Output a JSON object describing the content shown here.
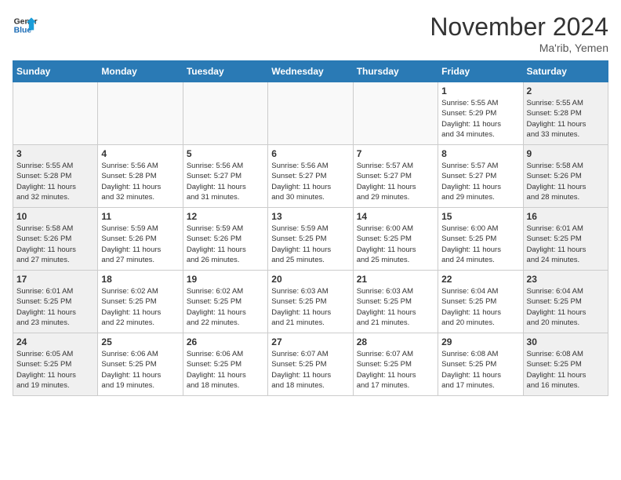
{
  "header": {
    "logo_line1": "General",
    "logo_line2": "Blue",
    "month": "November 2024",
    "location": "Ma'rib, Yemen"
  },
  "weekdays": [
    "Sunday",
    "Monday",
    "Tuesday",
    "Wednesday",
    "Thursday",
    "Friday",
    "Saturday"
  ],
  "weeks": [
    [
      {
        "day": "",
        "info": ""
      },
      {
        "day": "",
        "info": ""
      },
      {
        "day": "",
        "info": ""
      },
      {
        "day": "",
        "info": ""
      },
      {
        "day": "",
        "info": ""
      },
      {
        "day": "1",
        "info": "Sunrise: 5:55 AM\nSunset: 5:29 PM\nDaylight: 11 hours\nand 34 minutes."
      },
      {
        "day": "2",
        "info": "Sunrise: 5:55 AM\nSunset: 5:28 PM\nDaylight: 11 hours\nand 33 minutes."
      }
    ],
    [
      {
        "day": "3",
        "info": "Sunrise: 5:55 AM\nSunset: 5:28 PM\nDaylight: 11 hours\nand 32 minutes."
      },
      {
        "day": "4",
        "info": "Sunrise: 5:56 AM\nSunset: 5:28 PM\nDaylight: 11 hours\nand 32 minutes."
      },
      {
        "day": "5",
        "info": "Sunrise: 5:56 AM\nSunset: 5:27 PM\nDaylight: 11 hours\nand 31 minutes."
      },
      {
        "day": "6",
        "info": "Sunrise: 5:56 AM\nSunset: 5:27 PM\nDaylight: 11 hours\nand 30 minutes."
      },
      {
        "day": "7",
        "info": "Sunrise: 5:57 AM\nSunset: 5:27 PM\nDaylight: 11 hours\nand 29 minutes."
      },
      {
        "day": "8",
        "info": "Sunrise: 5:57 AM\nSunset: 5:27 PM\nDaylight: 11 hours\nand 29 minutes."
      },
      {
        "day": "9",
        "info": "Sunrise: 5:58 AM\nSunset: 5:26 PM\nDaylight: 11 hours\nand 28 minutes."
      }
    ],
    [
      {
        "day": "10",
        "info": "Sunrise: 5:58 AM\nSunset: 5:26 PM\nDaylight: 11 hours\nand 27 minutes."
      },
      {
        "day": "11",
        "info": "Sunrise: 5:59 AM\nSunset: 5:26 PM\nDaylight: 11 hours\nand 27 minutes."
      },
      {
        "day": "12",
        "info": "Sunrise: 5:59 AM\nSunset: 5:26 PM\nDaylight: 11 hours\nand 26 minutes."
      },
      {
        "day": "13",
        "info": "Sunrise: 5:59 AM\nSunset: 5:25 PM\nDaylight: 11 hours\nand 25 minutes."
      },
      {
        "day": "14",
        "info": "Sunrise: 6:00 AM\nSunset: 5:25 PM\nDaylight: 11 hours\nand 25 minutes."
      },
      {
        "day": "15",
        "info": "Sunrise: 6:00 AM\nSunset: 5:25 PM\nDaylight: 11 hours\nand 24 minutes."
      },
      {
        "day": "16",
        "info": "Sunrise: 6:01 AM\nSunset: 5:25 PM\nDaylight: 11 hours\nand 24 minutes."
      }
    ],
    [
      {
        "day": "17",
        "info": "Sunrise: 6:01 AM\nSunset: 5:25 PM\nDaylight: 11 hours\nand 23 minutes."
      },
      {
        "day": "18",
        "info": "Sunrise: 6:02 AM\nSunset: 5:25 PM\nDaylight: 11 hours\nand 22 minutes."
      },
      {
        "day": "19",
        "info": "Sunrise: 6:02 AM\nSunset: 5:25 PM\nDaylight: 11 hours\nand 22 minutes."
      },
      {
        "day": "20",
        "info": "Sunrise: 6:03 AM\nSunset: 5:25 PM\nDaylight: 11 hours\nand 21 minutes."
      },
      {
        "day": "21",
        "info": "Sunrise: 6:03 AM\nSunset: 5:25 PM\nDaylight: 11 hours\nand 21 minutes."
      },
      {
        "day": "22",
        "info": "Sunrise: 6:04 AM\nSunset: 5:25 PM\nDaylight: 11 hours\nand 20 minutes."
      },
      {
        "day": "23",
        "info": "Sunrise: 6:04 AM\nSunset: 5:25 PM\nDaylight: 11 hours\nand 20 minutes."
      }
    ],
    [
      {
        "day": "24",
        "info": "Sunrise: 6:05 AM\nSunset: 5:25 PM\nDaylight: 11 hours\nand 19 minutes."
      },
      {
        "day": "25",
        "info": "Sunrise: 6:06 AM\nSunset: 5:25 PM\nDaylight: 11 hours\nand 19 minutes."
      },
      {
        "day": "26",
        "info": "Sunrise: 6:06 AM\nSunset: 5:25 PM\nDaylight: 11 hours\nand 18 minutes."
      },
      {
        "day": "27",
        "info": "Sunrise: 6:07 AM\nSunset: 5:25 PM\nDaylight: 11 hours\nand 18 minutes."
      },
      {
        "day": "28",
        "info": "Sunrise: 6:07 AM\nSunset: 5:25 PM\nDaylight: 11 hours\nand 17 minutes."
      },
      {
        "day": "29",
        "info": "Sunrise: 6:08 AM\nSunset: 5:25 PM\nDaylight: 11 hours\nand 17 minutes."
      },
      {
        "day": "30",
        "info": "Sunrise: 6:08 AM\nSunset: 5:25 PM\nDaylight: 11 hours\nand 16 minutes."
      }
    ]
  ]
}
